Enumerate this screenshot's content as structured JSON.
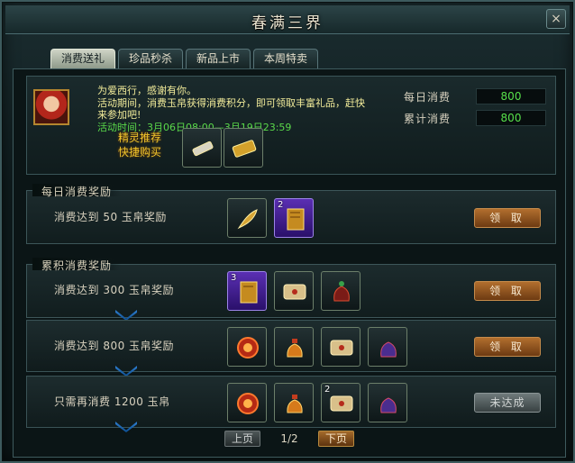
{
  "window": {
    "title": "春满三界",
    "close_label": "×"
  },
  "tabs": [
    {
      "label": "消费送礼",
      "active": true
    },
    {
      "label": "珍品秒杀",
      "active": false
    },
    {
      "label": "新品上市",
      "active": false
    },
    {
      "label": "本周特卖",
      "active": false
    }
  ],
  "info": {
    "announce_line1": "为爱西行，感谢有你。",
    "announce_line2": "活动期间，消费玉帛获得消费积分，即可领取丰富礼品，赶快来参加吧!",
    "activity_time_label": "活动时间：",
    "activity_time_value": "3月06日08:00—3月19日23:59",
    "daily_spend_label": "每日消费",
    "daily_spend_value": "800",
    "total_spend_label": "累计消费",
    "total_spend_value": "800",
    "quick_buy_line1": "精灵推荐",
    "quick_buy_line2": "快捷购买"
  },
  "daily_section": {
    "header": "每日消费奖励",
    "row_text": "消费达到  50  玉帛奖励",
    "slot2_count": "2",
    "claim_label": "领 取"
  },
  "total_section": {
    "header": "累积消费奖励",
    "rows": [
      {
        "text": "消费达到  300  玉帛奖励",
        "slot1_count": "3",
        "claim_label": "领 取"
      },
      {
        "text": "消费达到  800  玉帛奖励",
        "claim_label": "领 取"
      },
      {
        "text": "只需再消费  1200  玉帛",
        "slot3_count": "2",
        "claim_label": "未达成"
      }
    ]
  },
  "pager": {
    "prev_label": "上页",
    "indicator": "1/2",
    "next_label": "下页"
  },
  "colors": {
    "accent_green": "#57e04a",
    "announce_yellow": "#f2ec9a",
    "quick_buy_gold": "#f0c62c"
  }
}
